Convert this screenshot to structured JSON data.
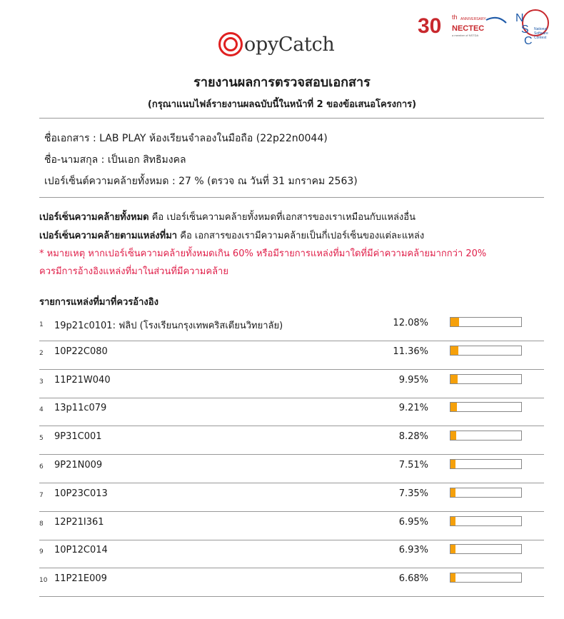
{
  "logos": {
    "nectec_number": "30",
    "nectec_th": "th",
    "nectec_anniversary": "ANNIVERSARY",
    "nectec_name": "NECTEC",
    "nectec_tagline": "a member of NSTDA",
    "nsc_letters": [
      "N",
      "S",
      "C"
    ],
    "nsc_text": [
      "National",
      "Software",
      "Contest"
    ],
    "brand_text": "opyCatch"
  },
  "colors": {
    "accent_red": "#e0204a",
    "bar_fill": "#f5a00a",
    "logo_red": "#c8282d",
    "logo_blue": "#1e5aa8"
  },
  "header": {
    "title": "รายงานผลการตรวจสอบเอกสาร",
    "subtitle": "(กรุณาแนบไฟล์รายงานผลฉบับนี้ในหน้าที่ 2 ของข้อเสนอโครงการ)"
  },
  "info": {
    "doc_label": "ชื่อเอกสาร : LAB PLAY ห้องเรียนจำลองในมือถือ (22p22n0044)",
    "name_label": "ชื่อ-นามสกุล : เป็นเอก สิทธิมงคล",
    "percent_label": "เปอร์เซ็นต์ความคล้ายทั้งหมด : 27 %   (ตรวจ ณ วันที่ 31 มกราคม 2563)"
  },
  "definitions": {
    "total_term": "เปอร์เซ็นความคล้ายทั้งหมด",
    "total_desc": " คือ เปอร์เซ็นความคล้ายทั้งหมดที่เอกสารของเราเหมือนกับแหล่งอื่น",
    "source_term": "เปอร์เซ็นความคล้ายตามแหล่งที่มา",
    "source_desc": " คือ เอกสารของเรามีความคล้ายเป็นกี่เปอร์เซ็นของแต่ละแหล่ง"
  },
  "note": {
    "line1": "* หมายเหตุ หากเปอร์เซ็นความคล้ายทั้งหมดเกิน 60% หรือมีรายการแหล่งที่มาใดที่มีค่าความคล้ายมากกว่า 20%",
    "line2": "ควรมีการอ้างอิงแหล่งที่มาในส่วนที่มีความคล้าย"
  },
  "list_title": "รายการแหล่งที่มาที่ควรอ้างอิง",
  "sources": [
    {
      "num": "1",
      "name": "19p21c0101: ฟลิป (โรงเรียนกรุงเทพคริสเตียนวิทยาลัย)",
      "percent": "12.08%",
      "value": 12.08
    },
    {
      "num": "2",
      "name": "10P22C080",
      "percent": "11.36%",
      "value": 11.36
    },
    {
      "num": "3",
      "name": "11P21W040",
      "percent": "9.95%",
      "value": 9.95
    },
    {
      "num": "4",
      "name": "13p11c079",
      "percent": "9.21%",
      "value": 9.21
    },
    {
      "num": "5",
      "name": "9P31C001",
      "percent": "8.28%",
      "value": 8.28
    },
    {
      "num": "6",
      "name": "9P21N009",
      "percent": "7.51%",
      "value": 7.51
    },
    {
      "num": "7",
      "name": "10P23C013",
      "percent": "7.35%",
      "value": 7.35
    },
    {
      "num": "8",
      "name": "12P21I361",
      "percent": "6.95%",
      "value": 6.95
    },
    {
      "num": "9",
      "name": "10P12C014",
      "percent": "6.93%",
      "value": 6.93
    },
    {
      "num": "10",
      "name": "11P21E009",
      "percent": "6.68%",
      "value": 6.68
    }
  ]
}
